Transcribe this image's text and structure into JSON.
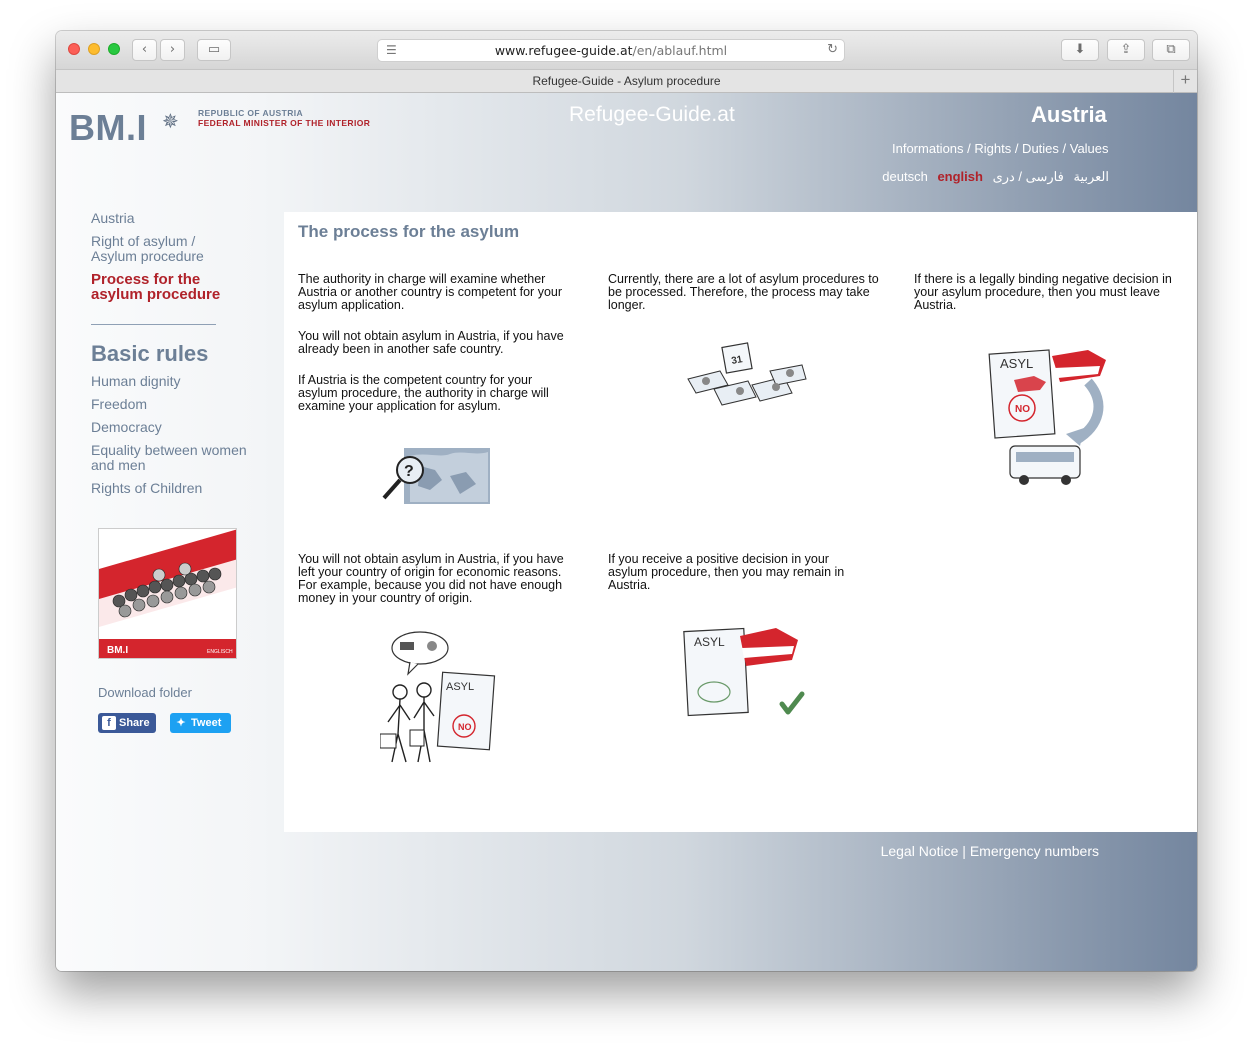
{
  "browser": {
    "url_host": "www.refugee-guide.at",
    "url_path": "/en/ablauf.html",
    "tab_title": "Refugee-Guide - Asylum procedure"
  },
  "header": {
    "logo_text": "BM.I",
    "republic": "REPUBLIC OF AUSTRIA",
    "ministry": "FEDERAL MINISTER OF THE INTERIOR",
    "site_name": "Refugee-Guide.at",
    "country": "Austria",
    "info_links": "Informations / Rights / Duties / Values",
    "languages": [
      "deutsch",
      "english",
      "العربية",
      "فارسی / دری"
    ],
    "active_language": "english"
  },
  "sidebar": {
    "nav": [
      "Austria",
      "Right of asylum / Asylum procedure",
      "Process for the asylum procedure"
    ],
    "section_title": "Basic rules",
    "rules": [
      "Human dignity",
      "Freedom",
      "Democracy",
      "Equality between women and men",
      "Rights of Children"
    ],
    "download": "Download folder",
    "share": "Share",
    "tweet": "Tweet",
    "cover_logo": "BM.I",
    "cover_lang": "ENGLISCH"
  },
  "content": {
    "title": "The process for the asylum",
    "col1_p1": "The authority in charge will examine whether Austria or another country is competent for your asylum application.",
    "col1_p2": "You will not obtain asylum in Austria, if you have already been in another safe country.",
    "col1_p3": "If Austria is the competent country for your asylum procedure, the authority in charge will examine your application for asylum.",
    "col2_p1": "Currently, there are a lot of asylum procedures to be processed. Therefore, the process may take longer.",
    "col3_p1": "If there is a legally binding negative decision in your asylum procedure, then you must leave Austria.",
    "row2_col1": "You will not obtain asylum in Austria, if you have left your country of origin for economic reasons. For example, because you did not have enough money in your country of origin.",
    "row2_col2": "If you receive a positive decision in your asylum procedure, then you may remain in Austria.",
    "asyl_label": "ASYL",
    "no_stamp": "NO",
    "calendar_day": "31"
  },
  "footer": {
    "legal": "Legal Notice",
    "separator": "|",
    "emergency": "Emergency numbers"
  },
  "colors": {
    "brand_blue_gray": "#6c7f96",
    "accent_red": "#b0222a"
  }
}
